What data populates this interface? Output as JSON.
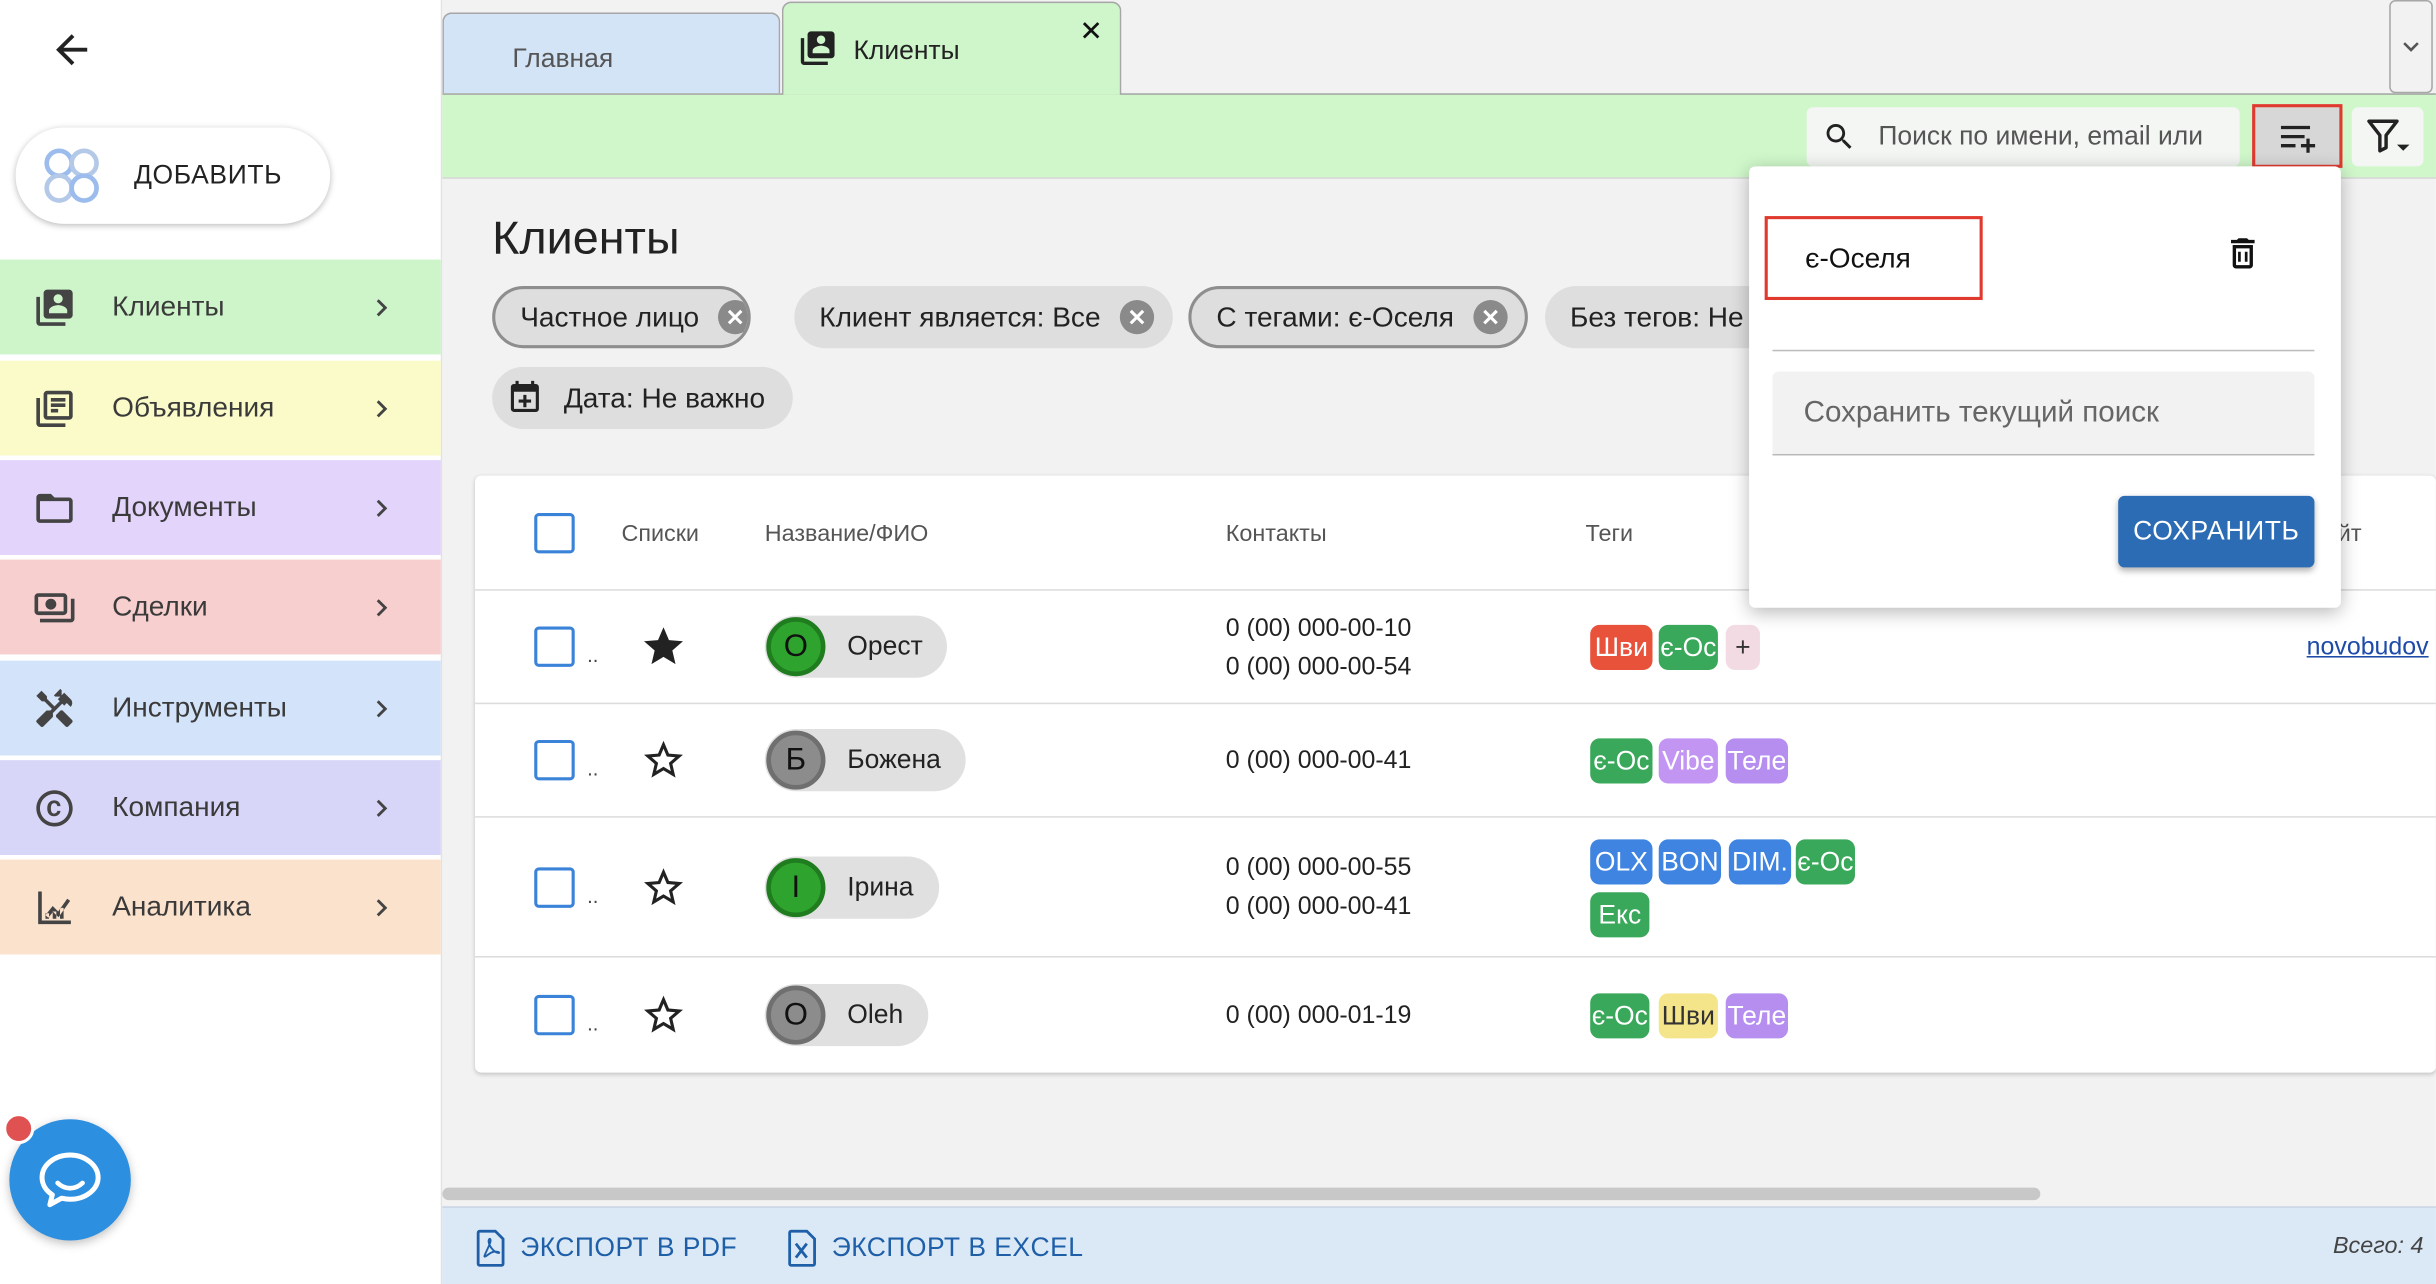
{
  "sidebar": {
    "add_label": "ДОБАВИТЬ",
    "items": [
      {
        "label": "Клиенты",
        "icon": "contacts-icon",
        "color": "#cef5ca"
      },
      {
        "label": "Объявления",
        "icon": "listings-icon",
        "color": "#fbfbc9"
      },
      {
        "label": "Документы",
        "icon": "folder-icon",
        "color": "#e3d4fb"
      },
      {
        "label": "Сделки",
        "icon": "money-icon",
        "color": "#f7cfcf"
      },
      {
        "label": "Инструменты",
        "icon": "tools-icon",
        "color": "#d3e4fa"
      },
      {
        "label": "Компания",
        "icon": "copyright-icon",
        "color": "#d8d6f8"
      },
      {
        "label": "Аналитика",
        "icon": "analytics-icon",
        "color": "#fbe2cc"
      }
    ]
  },
  "tabs": {
    "home": "Главная",
    "clients": "Клиенты",
    "close": "✕"
  },
  "toolbar": {
    "search_placeholder": "Поиск по имени, email или"
  },
  "page": {
    "title": "Клиенты"
  },
  "filters": {
    "chip1": "Частное лицо",
    "chip2": "Клиент является: Все",
    "chip3": "С тегами: є-Оселя",
    "chip4": "Без тегов: Не",
    "date": "Дата: Не важно"
  },
  "table": {
    "headers": {
      "lists": "Списки",
      "name": "Название/ФИО",
      "contacts": "Контакты",
      "tags": "Теги",
      "site": "йт"
    },
    "rows": [
      {
        "starred": true,
        "initial": "О",
        "avatar_color": "#2ea42e",
        "name": "Орест",
        "phone1": "0 (00) 000-00-10",
        "phone2": "0 (00) 000-00-54",
        "tags": [
          {
            "text": "Шви",
            "color": "#e8523a"
          },
          {
            "text": "є-Ос",
            "color": "#3aa85a"
          },
          {
            "text": "+",
            "color": "#f3dbe4"
          }
        ],
        "site": "novobudov"
      },
      {
        "starred": false,
        "initial": "Б",
        "avatar_color": "#8c8c8c",
        "name": "Божена",
        "phone1": "0 (00) 000-00-41",
        "phone2": "",
        "tags": [
          {
            "text": "є-Ос",
            "color": "#3aa85a"
          },
          {
            "text": "Vibe",
            "color": "#c395f3"
          },
          {
            "text": "Теле",
            "color": "#b58ef0"
          }
        ],
        "site": ""
      },
      {
        "starred": false,
        "initial": "І",
        "avatar_color": "#2ea42e",
        "name": "Ірина",
        "phone1": "0 (00) 000-00-55",
        "phone2": "0 (00) 000-00-41",
        "tags": [
          {
            "text": "OLX",
            "color": "#3e84e0"
          },
          {
            "text": "BON",
            "color": "#3e84e0"
          },
          {
            "text": "DIM.",
            "color": "#3e84e0"
          },
          {
            "text": "є-Ос",
            "color": "#3aa85a"
          },
          {
            "text": "Екс",
            "color": "#3aa85a"
          }
        ],
        "site": ""
      },
      {
        "starred": false,
        "initial": "О",
        "avatar_color": "#8c8c8c",
        "name": "Oleh",
        "phone1": "0 (00) 000-01-19",
        "phone2": "",
        "tags": [
          {
            "text": "є-Ос",
            "color": "#3aa85a"
          },
          {
            "text": "Шви",
            "color": "#f5e58a"
          },
          {
            "text": "Теле",
            "color": "#b58ef0"
          }
        ],
        "site": ""
      }
    ]
  },
  "footer": {
    "export_pdf": "ЭКСПОРТ В PDF",
    "export_excel": "ЭКСПОРТ В EXCEL",
    "total": "Всего: 4"
  },
  "popup": {
    "saved_item": "є-Оселя",
    "save_placeholder": "Сохранить текущий поиск",
    "save_button": "СОХРАНИТЬ"
  },
  "colors": {
    "accent_red_outline": "#e03a2f",
    "primary_blue": "#2b6cb4",
    "toolbar_green": "#cff7ca"
  }
}
